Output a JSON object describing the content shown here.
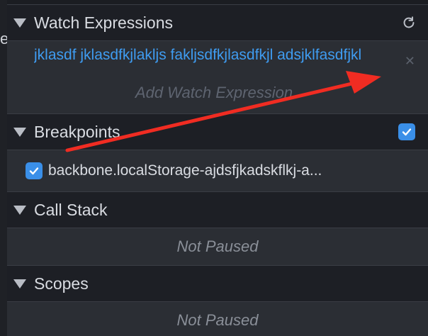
{
  "watch": {
    "header": "Watch Expressions",
    "expression": "jklasdf jklasdfkjlakljs fakljsdfkjlasdfkjl adsjklfasdfjkl",
    "add_placeholder": "Add Watch Expression",
    "icons": {
      "refresh": "refresh-icon",
      "remove": "close-icon"
    }
  },
  "breakpoints": {
    "header": "Breakpoints",
    "enabled": true,
    "items": [
      {
        "label": "backbone.localStorage-ajdsfjkadskflkj-a...",
        "checked": true
      }
    ]
  },
  "call_stack": {
    "header": "Call Stack",
    "status": "Not Paused"
  },
  "scopes": {
    "header": "Scopes",
    "status": "Not Paused"
  },
  "left_strip": {
    "glyph": "e"
  },
  "colors": {
    "accent_blue": "#3a8fe8",
    "link_blue": "#3f9cf1",
    "annotation_arrow": "#f02c22",
    "header_bg": "#1d1f25",
    "body_bg": "#2b2e34"
  }
}
